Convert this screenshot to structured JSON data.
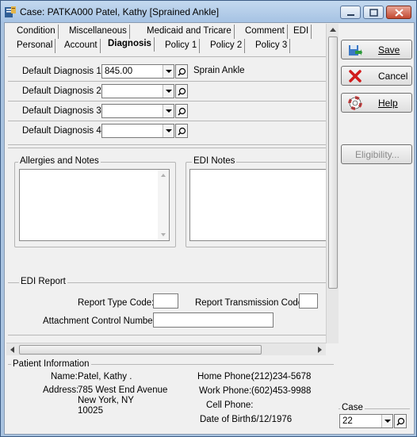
{
  "window": {
    "title": "Case: PATKA000 Patel, Kathy  [Sprained Ankle]"
  },
  "tabs_row1": [
    "Condition",
    "Miscellaneous",
    "Medicaid and Tricare",
    "Comment",
    "EDI"
  ],
  "tabs_row2": [
    "Personal",
    "Account",
    "Diagnosis",
    "Policy 1",
    "Policy 2",
    "Policy 3"
  ],
  "active_tab": "Diagnosis",
  "diagnoses": [
    {
      "label": "Default Diagnosis 1:",
      "value": "845.00",
      "description": "Sprain Ankle"
    },
    {
      "label": "Default Diagnosis 2:",
      "value": "",
      "description": ""
    },
    {
      "label": "Default Diagnosis 3:",
      "value": "",
      "description": ""
    },
    {
      "label": "Default Diagnosis 4:",
      "value": "",
      "description": ""
    }
  ],
  "notes": {
    "allergies_title": "Allergies and Notes",
    "allergies_value": "",
    "edi_title": "EDI Notes",
    "edi_value": ""
  },
  "edi_report": {
    "title": "EDI Report",
    "report_type_label": "Report Type Code:",
    "report_type_value": "",
    "transmission_label": "Report Transmission Code:",
    "transmission_value": "",
    "attachment_label": "Attachment Control Number:",
    "attachment_value": ""
  },
  "buttons": {
    "save": "Save",
    "cancel": "Cancel",
    "help": "Help",
    "eligibility": "Eligibility..."
  },
  "patient": {
    "title": "Patient Information",
    "name_label": "Name:",
    "name": "Patel, Kathy .",
    "address_label": "Address:",
    "address1": "785 West End Avenue",
    "address2": "New York, NY",
    "address3": "10025",
    "home_phone_label": "Home Phone:",
    "home_phone": "(212)234-5678",
    "work_phone_label": "Work Phone:",
    "work_phone": "(602)453-9988",
    "cell_phone_label": "Cell Phone:",
    "cell_phone": "",
    "dob_label": "Date of Birth:",
    "dob": "6/12/1976"
  },
  "case": {
    "label": "Case",
    "value": "22"
  },
  "colors": {
    "titlebar": "#a5c2e3",
    "face": "#f0f0f0",
    "close_button": "#c44a32"
  }
}
